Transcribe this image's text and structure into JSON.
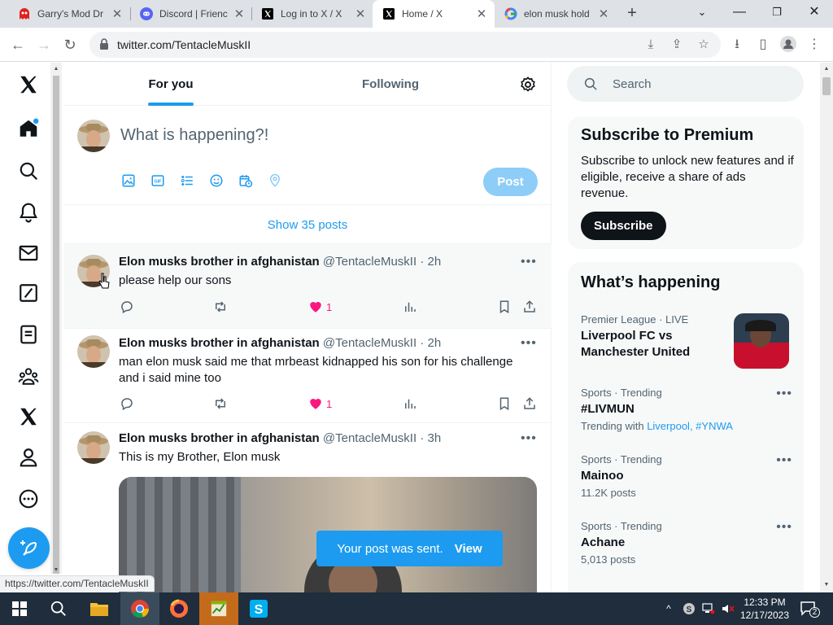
{
  "browser": {
    "tabs": [
      {
        "title": "Garry's Mod Dr",
        "active": false
      },
      {
        "title": "Discord | Frienc",
        "active": false
      },
      {
        "title": "Log in to X / X",
        "active": false
      },
      {
        "title": "Home / X",
        "active": true
      },
      {
        "title": "elon musk hold",
        "active": false
      }
    ],
    "url": "twitter.com/TentacleMuskII",
    "status_url": "https://twitter.com/TentacleMuskII"
  },
  "feed": {
    "tabs": [
      "For you",
      "Following"
    ],
    "composer_placeholder": "What is happening?!",
    "post_label": "Post",
    "show_posts": "Show 35 posts",
    "tweets": [
      {
        "name": "Elon musks brother in afghanistan",
        "handle": "@TentacleMuskII",
        "time": "· 2h",
        "text": "please help our sons",
        "likes": "1"
      },
      {
        "name": "Elon musks brother in afghanistan",
        "handle": "@TentacleMuskII",
        "time": "· 2h",
        "text": "man elon musk said me that mrbeast kidnapped his son for his challenge and i said mine too",
        "likes": "1"
      },
      {
        "name": "Elon musks brother in afghanistan",
        "handle": "@TentacleMuskII",
        "time": "· 3h",
        "text": "This is my Brother, Elon musk"
      }
    ],
    "toast": {
      "message": "Your post was sent.",
      "action": "View"
    }
  },
  "sidebar": {
    "search_placeholder": "Search",
    "premium": {
      "title": "Subscribe to Premium",
      "body": "Subscribe to unlock new features and if eligible, receive a share of ads revenue.",
      "button": "Subscribe"
    },
    "happening": {
      "title": "What’s happening",
      "trends": [
        {
          "meta": "Premier League · LIVE",
          "name": "Liverpool FC vs Manchester United"
        },
        {
          "meta": "Sports · Trending",
          "name": "#LIVMUN",
          "with_prefix": "Trending with",
          "with_links": "Liverpool, #YNWA"
        },
        {
          "meta": "Sports · Trending",
          "name": "Mainoo",
          "posts": "11.2K posts"
        },
        {
          "meta": "Sports · Trending",
          "name": "Achane",
          "posts": "5,013 posts"
        }
      ]
    }
  },
  "taskbar": {
    "time": "12:33 PM",
    "date": "12/17/2023",
    "notifications": "2"
  },
  "colors": {
    "accent": "#1d9bf0",
    "like": "#f91880",
    "taskbar": "#1f2d3c"
  }
}
